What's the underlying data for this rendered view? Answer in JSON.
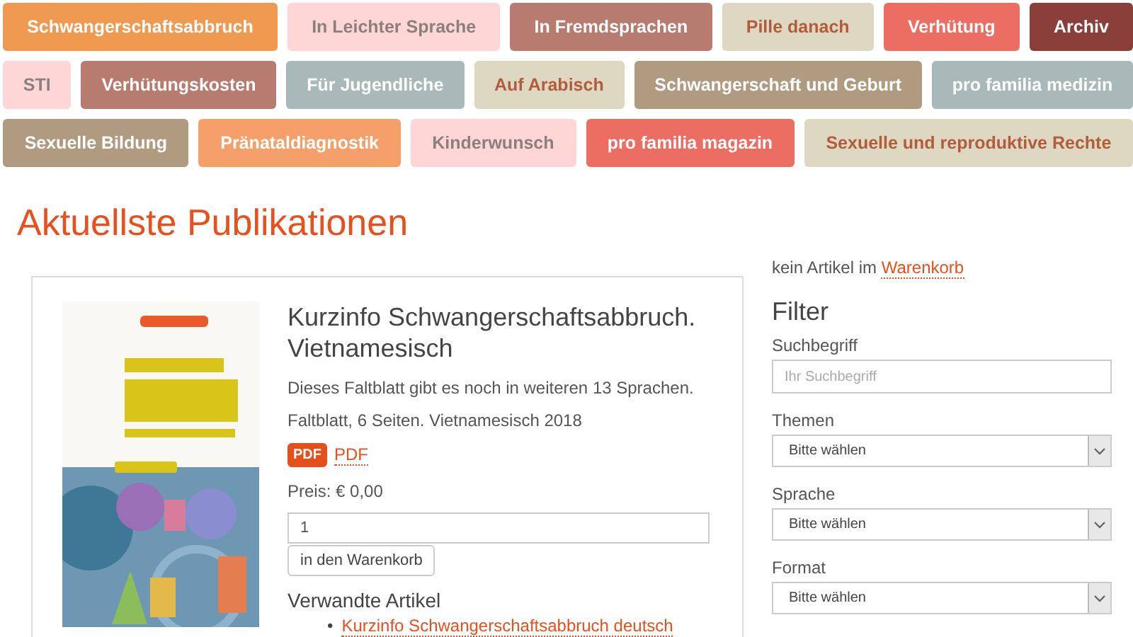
{
  "nav": {
    "rows": [
      [
        {
          "label": "Schwangerschaftsabbruch",
          "color": "#ef9a50"
        },
        {
          "label": "In Leichter Sprache",
          "color": "#ffd6d6"
        },
        {
          "label": "In Fremdsprachen",
          "color": "#b87b70"
        },
        {
          "label": "Pille danach",
          "color": "#ded8c2"
        },
        {
          "label": "Verhütung",
          "color": "#ec6e62"
        },
        {
          "label": "Archiv",
          "color": "#8b3f3a"
        }
      ],
      [
        {
          "label": "STI",
          "color": "#ffd6d6"
        },
        {
          "label": "Verhütungskosten",
          "color": "#b87b70"
        },
        {
          "label": "Für Jugendliche",
          "color": "#a9b8b8"
        },
        {
          "label": "Auf Arabisch",
          "color": "#ded8c2"
        },
        {
          "label": "Schwangerschaft und Geburt",
          "color": "#b09a80"
        },
        {
          "label": "pro familia medizin",
          "color": "#a9b8b8"
        }
      ],
      [
        {
          "label": "Sexuelle Bildung",
          "color": "#b09a80"
        },
        {
          "label": "Pränataldiagnostik",
          "color": "#f5a06a"
        },
        {
          "label": "Kinderwunsch",
          "color": "#ffd6d6"
        },
        {
          "label": "pro familia magazin",
          "color": "#ec6e62"
        },
        {
          "label": "Sexuelle und reproduktive Rechte",
          "color": "#ded8c2"
        }
      ]
    ]
  },
  "heading": "Aktuellste Publikationen",
  "publication": {
    "title": "Kurzinfo Schwangerschaftsabbruch. Vietnamesisch",
    "note": "Dieses Faltblatt gibt es noch in weiteren 13 Sprachen.",
    "details": "Faltblatt, 6 Seiten. Vietnamesisch 2018",
    "pdf_badge": "PDF",
    "pdf_link": "PDF",
    "price": "Preis: € 0,00",
    "quantity": "1",
    "cart_button": "in den Warenkorb",
    "related_heading": "Verwandte Artikel",
    "related": [
      {
        "marker": "•",
        "label": "Kurzinfo Schwangerschaftsabbruch deutsch"
      }
    ]
  },
  "sidebar": {
    "cart_status": "kein Artikel im",
    "cart_link": "Warenkorb",
    "filter_heading": "Filter",
    "search": {
      "label": "Suchbegriff",
      "placeholder": "Ihr Suchbegriff"
    },
    "selects": [
      {
        "label": "Themen",
        "value": "Bitte wählen"
      },
      {
        "label": "Sprache",
        "value": "Bitte wählen"
      },
      {
        "label": "Format",
        "value": "Bitte wählen"
      }
    ]
  }
}
